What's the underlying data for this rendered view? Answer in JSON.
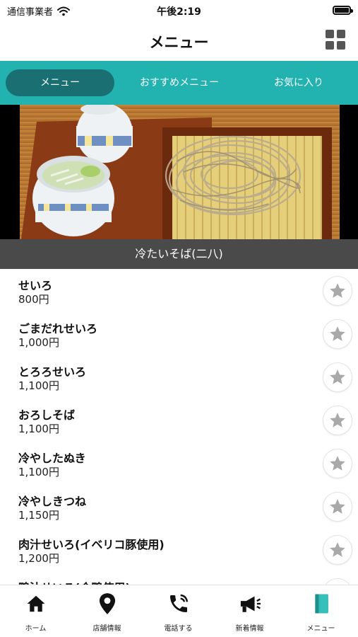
{
  "status_bar": {
    "carrier": "通信事業者",
    "time": "午後2:19"
  },
  "header": {
    "title": "メニュー"
  },
  "tabs": [
    {
      "label": "メニュー",
      "active": true
    },
    {
      "label": "おすすめメニュー",
      "active": false
    },
    {
      "label": "お気に入り",
      "active": false
    }
  ],
  "category": {
    "title": "冷たいそば(二八)"
  },
  "menu_items": [
    {
      "name": "せいろ",
      "price": "800円"
    },
    {
      "name": "ごまだれせいろ",
      "price": "1,000円"
    },
    {
      "name": "とろろせいろ",
      "price": "1,100円"
    },
    {
      "name": "おろしそば",
      "price": "1,100円"
    },
    {
      "name": "冷やしたぬき",
      "price": "1,100円"
    },
    {
      "name": "冷やしきつね",
      "price": "1,150円"
    },
    {
      "name": "肉汁せいろ(イベリコ豚使用)",
      "price": "1,200円"
    },
    {
      "name": "鴨汁せいろ(合鴨使用)",
      "price": ""
    }
  ],
  "bottom_nav": [
    {
      "label": "ホーム",
      "icon": "home-icon"
    },
    {
      "label": "店舗情報",
      "icon": "map-pin-icon"
    },
    {
      "label": "電話する",
      "icon": "phone-icon"
    },
    {
      "label": "新着情報",
      "icon": "megaphone-icon"
    },
    {
      "label": "メニュー",
      "icon": "book-icon"
    }
  ],
  "colors": {
    "accent": "#22b2b0",
    "active_tab": "#1a6f72",
    "category_bar": "#4a4a4a",
    "star": "#a9a9a9",
    "menu_icon_active": "#2fb8b4"
  }
}
